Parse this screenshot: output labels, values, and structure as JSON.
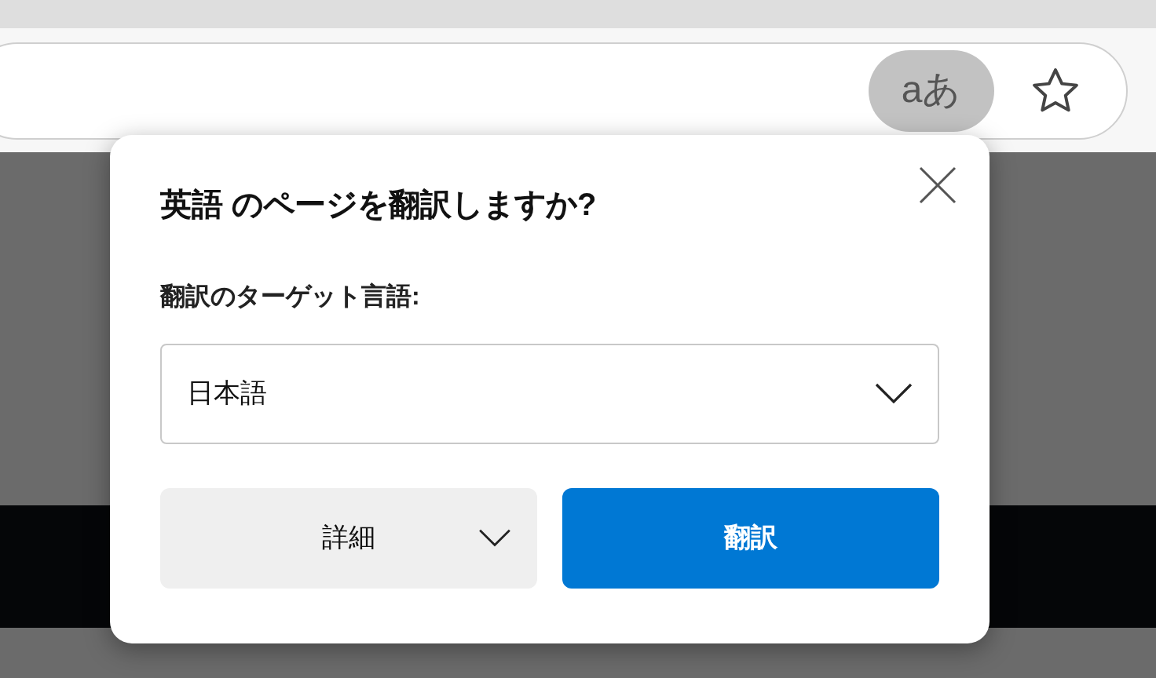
{
  "toolbar": {
    "translate_button": {
      "label": "aあ",
      "selected": true
    }
  },
  "dialog": {
    "title": "英語 のページを翻訳しますか?",
    "target_label": "翻訳のターゲット言語:",
    "language_select": {
      "value": "日本語"
    },
    "details_button": {
      "label": "詳細"
    },
    "translate_button": {
      "label": "翻訳"
    }
  }
}
